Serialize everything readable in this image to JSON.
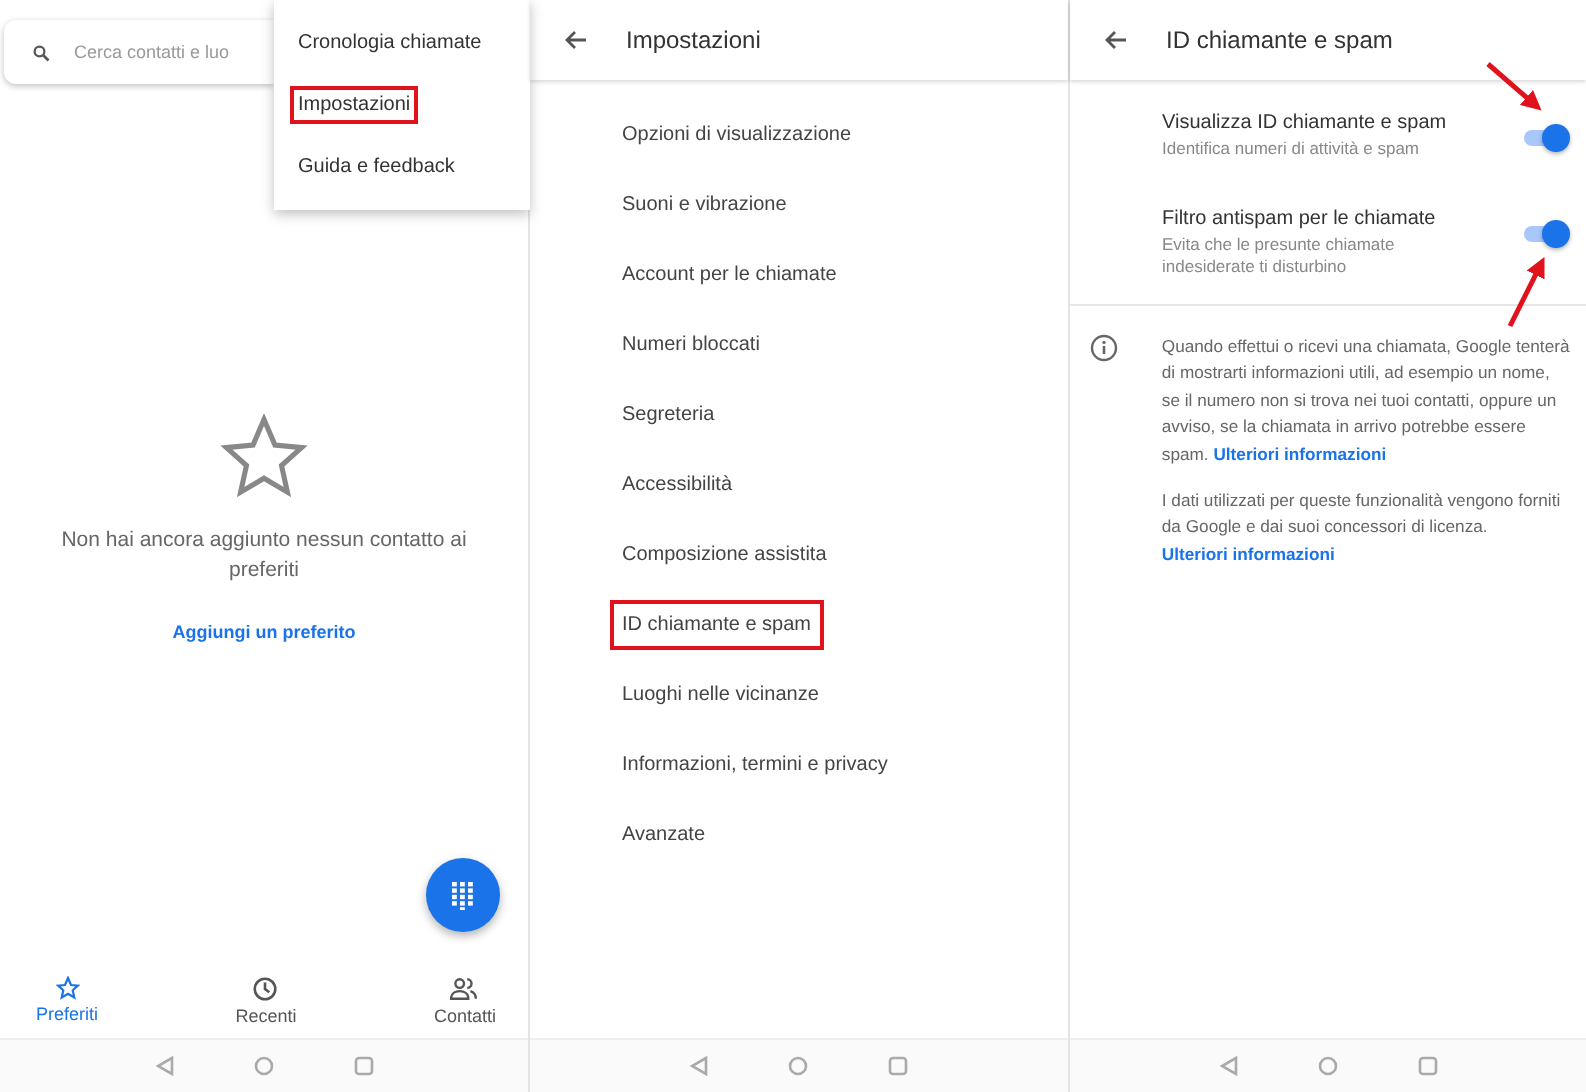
{
  "favorites_screen": {
    "search": {
      "placeholder": "Cerca contatti e luo"
    },
    "menu": [
      {
        "label": "Cronologia chiamate",
        "highlighted": false
      },
      {
        "label": "Impostazioni",
        "highlighted": true
      },
      {
        "label": "Guida e feedback",
        "highlighted": false
      }
    ],
    "empty_state": {
      "message": "Non hai ancora aggiunto nessun contatto ai preferiti",
      "link": "Aggiungi un preferito"
    },
    "tabs": [
      {
        "label": "Preferiti",
        "selected": true
      },
      {
        "label": "Recenti",
        "selected": false
      },
      {
        "label": "Contatti",
        "selected": false
      }
    ]
  },
  "settings_screen": {
    "title": "Impostazioni",
    "items": [
      {
        "label": "Opzioni di visualizzazione",
        "highlighted": false
      },
      {
        "label": "Suoni e vibrazione",
        "highlighted": false
      },
      {
        "label": "Account per le chiamate",
        "highlighted": false
      },
      {
        "label": "Numeri bloccati",
        "highlighted": false
      },
      {
        "label": "Segreteria",
        "highlighted": false
      },
      {
        "label": "Accessibilità",
        "highlighted": false
      },
      {
        "label": "Composizione assistita",
        "highlighted": false
      },
      {
        "label": "ID chiamante e spam",
        "highlighted": true
      },
      {
        "label": "Luoghi nelle vicinanze",
        "highlighted": false
      },
      {
        "label": "Informazioni, termini e privacy",
        "highlighted": false
      },
      {
        "label": "Avanzate",
        "highlighted": false
      }
    ]
  },
  "caller_id_screen": {
    "title": "ID chiamante e spam",
    "switches": [
      {
        "title": "Visualizza ID chiamante e spam",
        "subtitle": "Identifica numeri di attività e spam",
        "on": true
      },
      {
        "title": "Filtro antispam per le chiamate",
        "subtitle": "Evita che le presunte chiamate indesiderate ti disturbino",
        "on": true
      }
    ],
    "info": [
      {
        "text": "Quando effettui o ricevi una chiamata, Google tenterà di mostrarti informazioni utili, ad esempio un nome, se il numero non si trova nei tuoi contatti, oppure un avviso, se la chiamata in arrivo potrebbe essere spam.",
        "link": "Ulteriori informazioni"
      },
      {
        "text": "I dati utilizzati per queste funzionalità vengono forniti da Google e dai suoi concessori di licenza.",
        "link": "Ulteriori informazioni"
      }
    ]
  }
}
